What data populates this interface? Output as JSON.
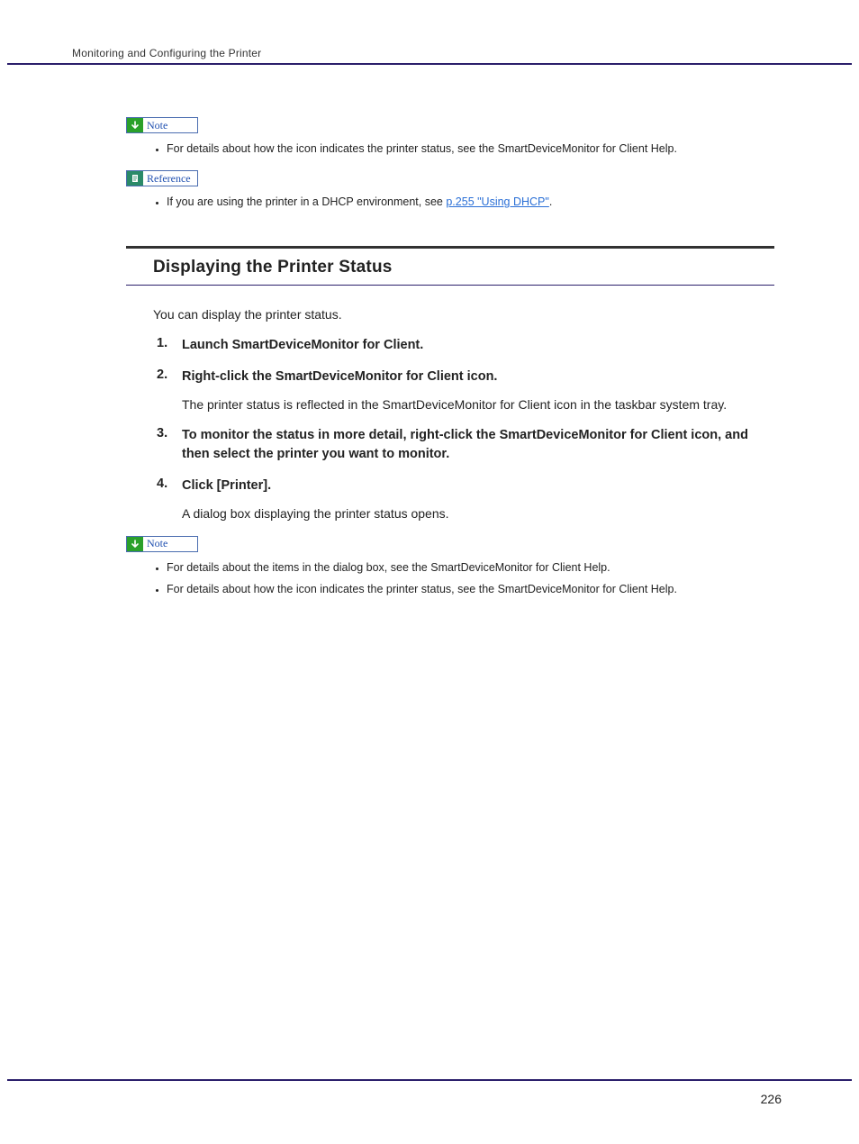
{
  "header": {
    "running_title": "Monitoring and Configuring the Printer"
  },
  "callouts": {
    "note": "Note",
    "reference": "Reference"
  },
  "note1": {
    "items": [
      "For details about how the icon indicates the printer status, see the SmartDeviceMonitor for Client Help."
    ]
  },
  "reference": {
    "prefix": "If you are using the printer in a DHCP environment, see ",
    "link_text": "p.255 \"Using DHCP\"",
    "suffix": "."
  },
  "section": {
    "title": "Displaying the Printer Status",
    "intro": "You can display the printer status.",
    "steps": [
      {
        "head": "Launch SmartDeviceMonitor for Client."
      },
      {
        "head": "Right-click the SmartDeviceMonitor for Client icon.",
        "sub": "The printer status is reflected in the SmartDeviceMonitor for Client icon in the taskbar system tray."
      },
      {
        "head": "To monitor the status in more detail, right-click the SmartDeviceMonitor for Client icon, and then select the printer you want to monitor."
      },
      {
        "head": "Click [Printer].",
        "sub": "A dialog box displaying the printer status opens."
      }
    ]
  },
  "note2": {
    "items": [
      "For details about the items in the dialog box, see the SmartDeviceMonitor for Client Help.",
      "For details about how the icon indicates the printer status, see the SmartDeviceMonitor for Client Help."
    ]
  },
  "footer": {
    "page_number": "226"
  }
}
